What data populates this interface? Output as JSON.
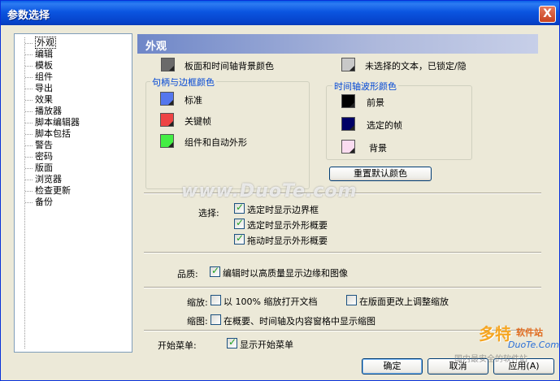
{
  "window": {
    "title": "参数选择",
    "close_label": "X"
  },
  "nav": {
    "items": [
      {
        "label": "外观",
        "selected": true
      },
      {
        "label": "编辑"
      },
      {
        "label": "模板"
      },
      {
        "label": "组件"
      },
      {
        "label": "导出"
      },
      {
        "label": "效果"
      },
      {
        "label": "播放器"
      },
      {
        "label": "脚本编辑器"
      },
      {
        "label": "脚本包括"
      },
      {
        "label": "警告"
      },
      {
        "label": "密码"
      },
      {
        "label": "版面"
      },
      {
        "label": "浏览器"
      },
      {
        "label": "检查更新"
      },
      {
        "label": "备份"
      }
    ]
  },
  "panel": {
    "title": "外观",
    "bg_color_label": "板面和时间轴背景颜色",
    "unselected_text_label": "未选择的文本，已锁定/隐",
    "handle_group": {
      "title": "句柄与边框颜色",
      "items": [
        {
          "label": "标准",
          "color": "#5577ee"
        },
        {
          "label": "关键帧",
          "color": "#ee4444"
        },
        {
          "label": "组件和自动外形",
          "color": "#44ee44"
        }
      ]
    },
    "wave_group": {
      "title": "时间轴波形颜色",
      "items": [
        {
          "label": "前景",
          "color": "#000000"
        },
        {
          "label": "选定的帧",
          "color": "#000066"
        },
        {
          "label": "背景",
          "color": "#fadcf0"
        }
      ]
    },
    "reset_button": "重置默认颜色",
    "select": {
      "label": "选择:",
      "options": [
        {
          "label": "选定时显示边界框",
          "checked": true
        },
        {
          "label": "选定时显示外形概要",
          "checked": true
        },
        {
          "label": "拖动时显示外形概要",
          "checked": true
        }
      ]
    },
    "quality": {
      "label": "品质:",
      "option": {
        "label": "编辑时以高质量显示边缘和图像",
        "checked": true
      }
    },
    "zoom": {
      "label": "缩放:",
      "option1": {
        "label": "以 100% 缩放打开文档",
        "checked": false
      },
      "option2": {
        "label": "在版面更改上调整缩放",
        "checked": false
      }
    },
    "thumbnail": {
      "label": "缩图:",
      "option": {
        "label": "在概要、时间轴及内容窗格中显示缩图",
        "checked": false
      }
    },
    "start_menu": {
      "label": "开始菜单:",
      "option": {
        "label": "显示开始菜单",
        "checked": true
      }
    }
  },
  "buttons": {
    "ok": "确定",
    "cancel": "取消",
    "apply": "应用(A)"
  },
  "watermarks": {
    "center": "www.DuoTe.com",
    "corner_brand": "多特",
    "corner_sub": "软件站",
    "corner_url": "DuoTe.Com",
    "corner_note": "国内最安全的软件站"
  }
}
